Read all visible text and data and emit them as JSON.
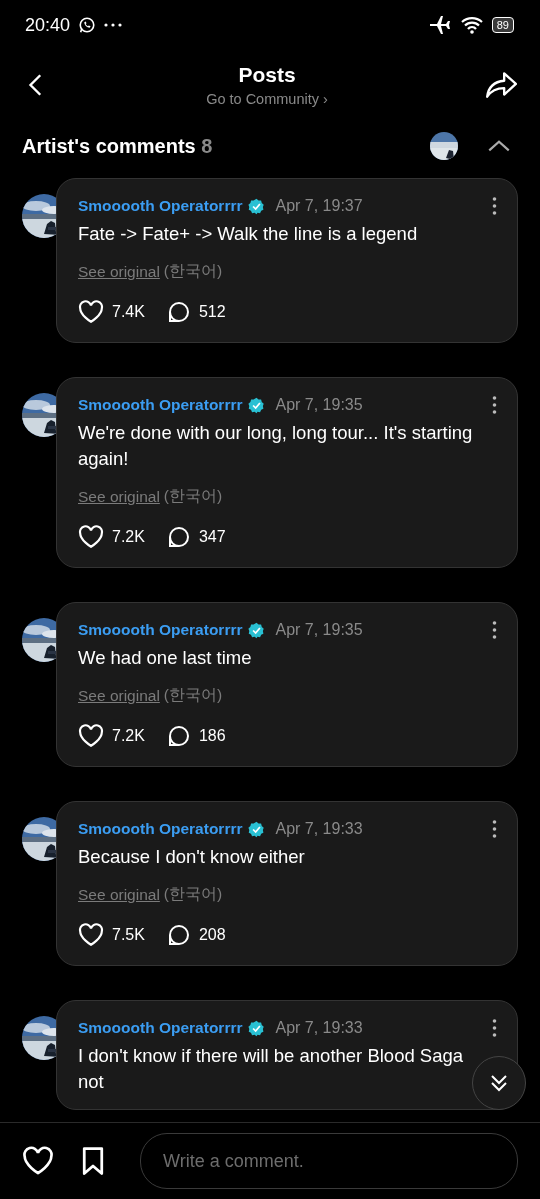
{
  "status_bar": {
    "time": "20:40",
    "battery": "89"
  },
  "header": {
    "title": "Posts",
    "subtitle": "Go to Community",
    "subtitle_arrow": "›"
  },
  "section": {
    "title": "Artist's comments",
    "count": "8",
    "expanded": true
  },
  "comments": [
    {
      "author": "Smooooth Operatorrrr",
      "verified": true,
      "time": "Apr 7, 19:37",
      "text": "Fate -> Fate+ -> Walk the line is a legend",
      "see_original": "See original",
      "language": "(한국어)",
      "likes": "7.4K",
      "replies": "512"
    },
    {
      "author": "Smooooth Operatorrrr",
      "verified": true,
      "time": "Apr 7, 19:35",
      "text": "We're done with our long, long tour... It's starting again!",
      "see_original": "See original",
      "language": "(한국어)",
      "likes": "7.2K",
      "replies": "347"
    },
    {
      "author": "Smooooth Operatorrrr",
      "verified": true,
      "time": "Apr 7, 19:35",
      "text": "We had one last time",
      "see_original": "See original",
      "language": "(한국어)",
      "likes": "7.2K",
      "replies": "186"
    },
    {
      "author": "Smooooth Operatorrrr",
      "verified": true,
      "time": "Apr 7, 19:33",
      "text": "Because I don't know either",
      "see_original": "See original",
      "language": "(한국어)",
      "likes": "7.5K",
      "replies": "208"
    },
    {
      "author": "Smooooth Operatorrrr",
      "verified": true,
      "time": "Apr 7, 19:33",
      "text": "I don't know if there will be another Blood Saga\nnot"
    }
  ],
  "composer": {
    "placeholder": "Write a comment."
  }
}
